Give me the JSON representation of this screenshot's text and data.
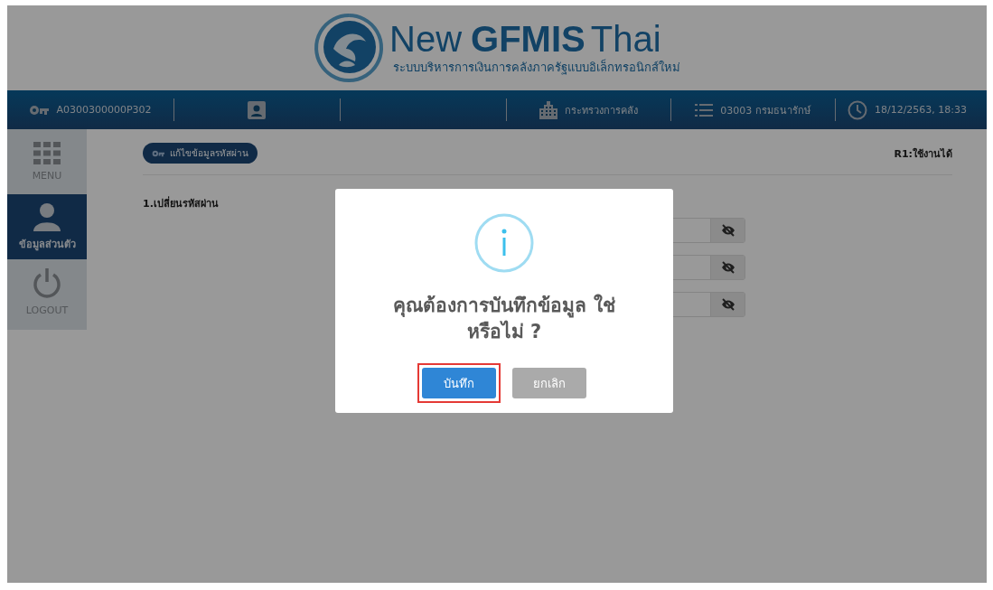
{
  "header": {
    "logo": {
      "new": "New",
      "gfmis": "GFMIS",
      "thai": "Thai",
      "subtitle": "ระบบบริหารการเงินการคลังภาครัฐแบบอิเล็กทรอนิกส์ใหม่"
    }
  },
  "info_bar": [
    {
      "kind": "key",
      "text": "A0300300000P302"
    },
    {
      "kind": "profile"
    },
    {
      "kind": "empty"
    },
    {
      "kind": "building",
      "text": "กระทรวงการคลัง"
    },
    {
      "kind": "list",
      "text": "03003 กรมธนารักษ์"
    },
    {
      "kind": "clock",
      "text": "18/12/2563, 18:33"
    }
  ],
  "sidebar": {
    "items": [
      {
        "kind": "menu",
        "label": "MENU",
        "selected": false
      },
      {
        "kind": "user",
        "label": "ข้อมูลส่วนตัว",
        "selected": true
      },
      {
        "kind": "logout",
        "label": "LOGOUT",
        "selected": false
      }
    ]
  },
  "content": {
    "pill": "แก้ไขข้อมูลรหัสผ่าน",
    "status": "R1:ใช้งานได้",
    "section_title": "1.เปลี่ยนรหัสผ่าน",
    "password_fields": [
      {
        "revealed": false
      },
      {
        "revealed": false
      },
      {
        "revealed": false
      }
    ]
  },
  "dialog": {
    "message": "คุณต้องการบันทึกข้อมูล ใช่หรือไม่ ?",
    "buttons": [
      {
        "kind": "primary",
        "label": "บันทึก",
        "highlighted": true
      },
      {
        "kind": "secondary",
        "label": "ยกเลิก",
        "highlighted": false
      }
    ]
  }
}
